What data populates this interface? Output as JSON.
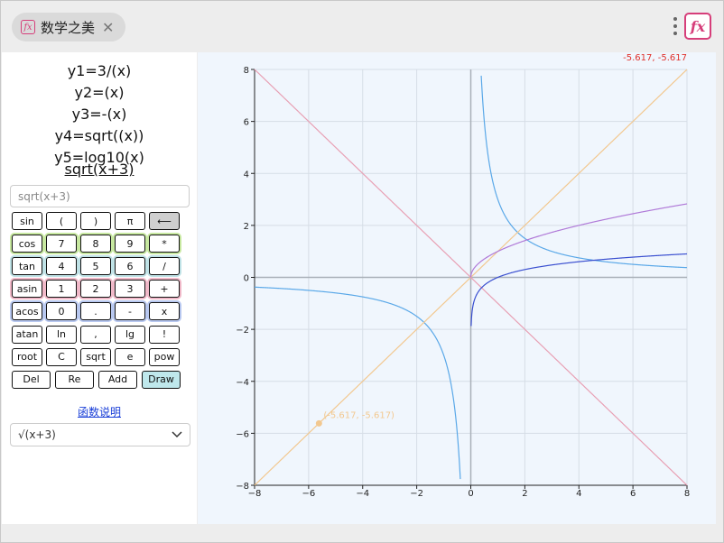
{
  "header": {
    "tab_title": "数学之美",
    "tab_icon": "fx-icon",
    "close_icon": "close-icon",
    "menu_icon": "kebab-menu-icon",
    "app_icon": "fx-icon",
    "icon_glyph": "fx",
    "close_glyph": "✕"
  },
  "functions": {
    "list": [
      "y1=3/(x)",
      "y2=(x)",
      "y3=-(x)",
      "y4=sqrt((x))",
      "y5=log10(x)"
    ],
    "current": "sqrt(x+3)"
  },
  "input": {
    "placeholder": "sqrt(x+3)"
  },
  "keypad": {
    "rows": [
      [
        "sin",
        "(",
        ")",
        "π",
        "⟵"
      ],
      [
        "cos",
        "7",
        "8",
        "9",
        "*"
      ],
      [
        "tan",
        "4",
        "5",
        "6",
        "/"
      ],
      [
        "asin",
        "1",
        "2",
        "3",
        "+"
      ],
      [
        "acos",
        "0",
        ".",
        "-",
        "x"
      ],
      [
        "atan",
        "ln",
        ",",
        "lg",
        "!"
      ],
      [
        "root",
        "C",
        "sqrt",
        "e",
        "pow"
      ],
      [
        "Del",
        "Re",
        "Add",
        "Draw"
      ]
    ],
    "row_colors": [
      "#111111",
      "#c7e8a0",
      "#bfe2e6",
      "#f0b8c8",
      "#b8c8f0",
      "#111111",
      "#111111",
      "#111111"
    ]
  },
  "help_link": "函数说明",
  "select": {
    "value": "√(x+3)"
  },
  "plot": {
    "coord_readout": "-5.617, -5.617",
    "point_label": "(-5.617, -5.617)",
    "colors": {
      "accent": "#d63e7a",
      "readout": "#e0302a",
      "y1": "#5aa8e8",
      "y2": "#f2c890",
      "y3": "#e8a0b4",
      "y4": "#b07ad8",
      "y5": "#3a4fd0"
    }
  },
  "chart_data": {
    "type": "line",
    "xlim": [
      -8,
      8
    ],
    "ylim": [
      -8,
      8
    ],
    "x_ticks": [
      "-8",
      "-6",
      "-4",
      "-2",
      "0",
      "2",
      "4",
      "6",
      "8"
    ],
    "y_ticks": [
      "8",
      "6",
      "4",
      "2",
      "0",
      "-2",
      "-4",
      "-6",
      "-8"
    ],
    "grid": true,
    "series": [
      {
        "expr": "3/x",
        "color": "#5aa8e8"
      },
      {
        "expr": "x",
        "color": "#f2c890"
      },
      {
        "expr": "-x",
        "color": "#e8a0b4"
      },
      {
        "expr": "sqrt(x)",
        "color": "#b07ad8"
      },
      {
        "expr": "log10(x)",
        "color": "#3a4fd0"
      }
    ],
    "marker": {
      "x": -5.617,
      "y": -5.617
    }
  }
}
